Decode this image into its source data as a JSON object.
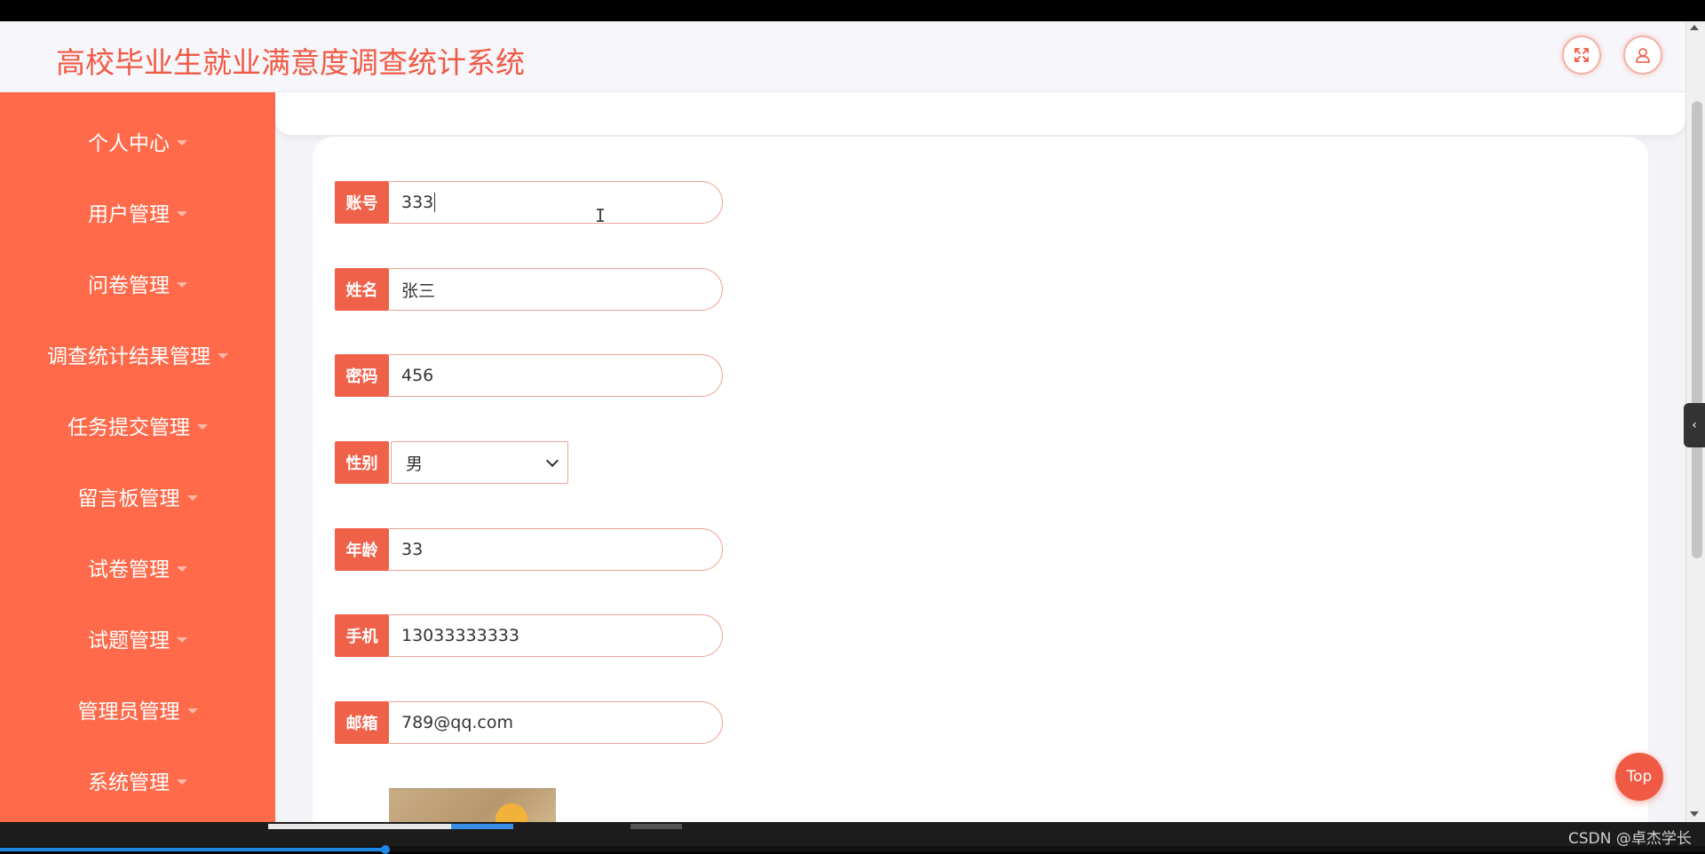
{
  "header": {
    "title": "高校毕业生就业满意度调查统计系统",
    "fullscreen_icon": "fullscreen-icon",
    "user_icon": "user-icon"
  },
  "sidebar": {
    "items": [
      {
        "label": "个人中心"
      },
      {
        "label": "用户管理"
      },
      {
        "label": "问卷管理"
      },
      {
        "label": "调查统计结果管理"
      },
      {
        "label": "任务提交管理"
      },
      {
        "label": "留言板管理"
      },
      {
        "label": "试卷管理"
      },
      {
        "label": "试题管理"
      },
      {
        "label": "管理员管理"
      },
      {
        "label": "系统管理"
      }
    ]
  },
  "form": {
    "account": {
      "label": "账号",
      "value": "333"
    },
    "name": {
      "label": "姓名",
      "value": "张三"
    },
    "password": {
      "label": "密码",
      "value": "456"
    },
    "gender": {
      "label": "性别",
      "value": "男"
    },
    "age": {
      "label": "年龄",
      "value": "33"
    },
    "phone": {
      "label": "手机",
      "value": "13033333333"
    },
    "email": {
      "label": "邮箱",
      "value": "789@qq.com"
    }
  },
  "top_button": "Top",
  "watermark": "CSDN @卓杰学长",
  "colors": {
    "accent": "#f05a45",
    "sidebar_bg": "#ff6a4a",
    "input_border": "#f0a396"
  }
}
